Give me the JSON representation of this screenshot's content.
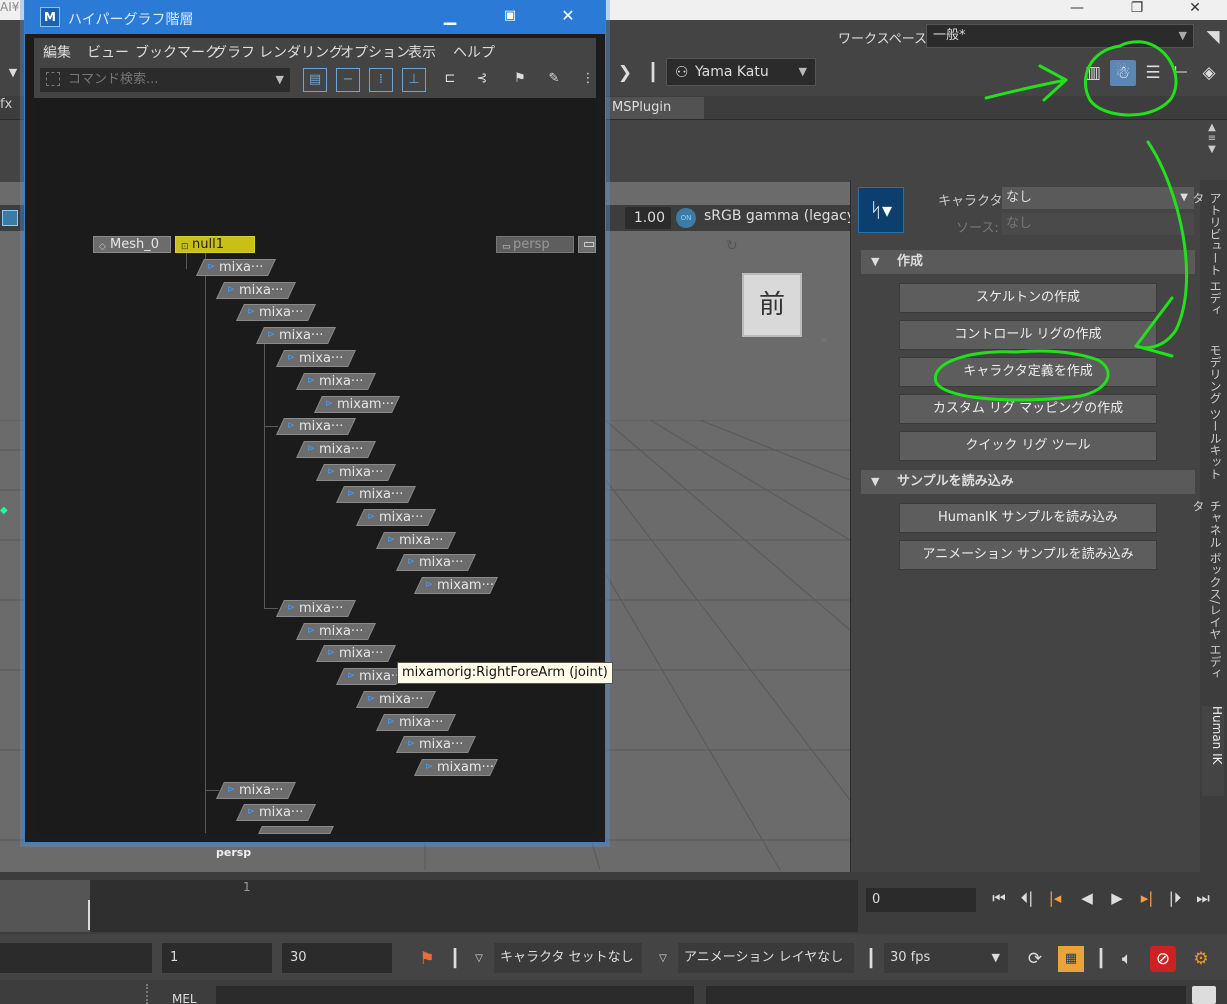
{
  "maya": {
    "title_fragment": "AI¥",
    "workspace_label": "ワークスペース:",
    "workspace_value": "一般*",
    "user_name": "Yama Katu",
    "shelf_tab": "MSPlugin",
    "shelf_tab_left": "fx",
    "gamma_value": "1.00",
    "gamma_toggle": "ON",
    "color_space": "sRGB gamma (legacy)",
    "viewcube_face": "前",
    "viewport_camera": "persp"
  },
  "hypergraph": {
    "title": "ハイパーグラフ階層",
    "app_icon": "M",
    "menus": [
      "編集",
      "ビュー",
      "ブックマーク",
      "グラフ",
      "レンダリング",
      "オプション",
      "表示",
      "ヘルプ"
    ],
    "search_placeholder": "コマンド検索...",
    "nodes": {
      "mesh": "Mesh_0",
      "null": "null1",
      "persp": "persp",
      "short": "mixa···",
      "long": "mixam···"
    },
    "tooltip": "mixamorig:RightForeArm (joint)"
  },
  "hik": {
    "character_label": "キャラクタ:",
    "character_value": "なし",
    "source_label": "ソース:",
    "source_value": "なし",
    "section_create": "作成",
    "btn_skeleton": "スケルトンの作成",
    "btn_control_rig": "コントロール リグの作成",
    "btn_define_character": "キャラクタ定義を作成",
    "btn_custom_rig": "カスタム リグ マッピングの作成",
    "btn_quick_rig": "クイック リグ ツール",
    "section_samples": "サンプルを読み込み",
    "btn_humanik_sample": "HumanIK サンプルを読み込み",
    "btn_anim_sample": "アニメーション サンプルを読み込み"
  },
  "side_tabs": [
    "アトリビュート エディタ",
    "モデリング ツールキット",
    "チャネル ボックス/レイヤ エディタ",
    "Human IK"
  ],
  "timeline": {
    "tick_label": "1",
    "current_frame": "0"
  },
  "range": {
    "start": "1",
    "end": "30",
    "character_set": "キャラクタ セットなし",
    "anim_layer": "アニメーション レイヤなし",
    "fps": "30 fps"
  },
  "command_line": {
    "label": "MEL"
  },
  "colors": {
    "annotation": "#22e01a",
    "null_node": "#c8c016",
    "titlebar": "#2b7bd6"
  }
}
